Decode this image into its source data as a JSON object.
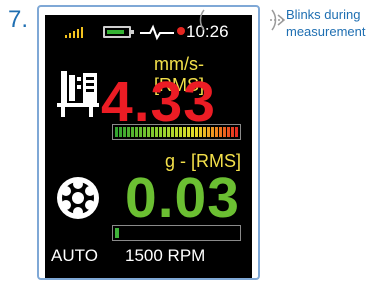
{
  "step_number": "7.",
  "status_bar": {
    "time": "10:26",
    "signal_bars": 5,
    "battery_level": 0.85,
    "icons": [
      "signal-icon",
      "battery-icon",
      "pulse-icon",
      "record-dot-icon"
    ]
  },
  "callout": {
    "line1": "Blinks during",
    "line2": "measurement"
  },
  "velocity": {
    "unit_label": "mm/s-[RMS]",
    "value": "4.33",
    "bar_level": 1.0,
    "color": "#ec1c24"
  },
  "acceleration": {
    "unit_label": "g - [RMS]",
    "value": "0.03",
    "bar_level": 0.03,
    "color": "#6bbf32"
  },
  "footer": {
    "mode": "AUTO",
    "speed": "1500 RPM"
  },
  "colors": {
    "accent_blue": "#1f6fb2",
    "unit_yellow": "#f3e04a",
    "screen_bg": "#000000"
  }
}
